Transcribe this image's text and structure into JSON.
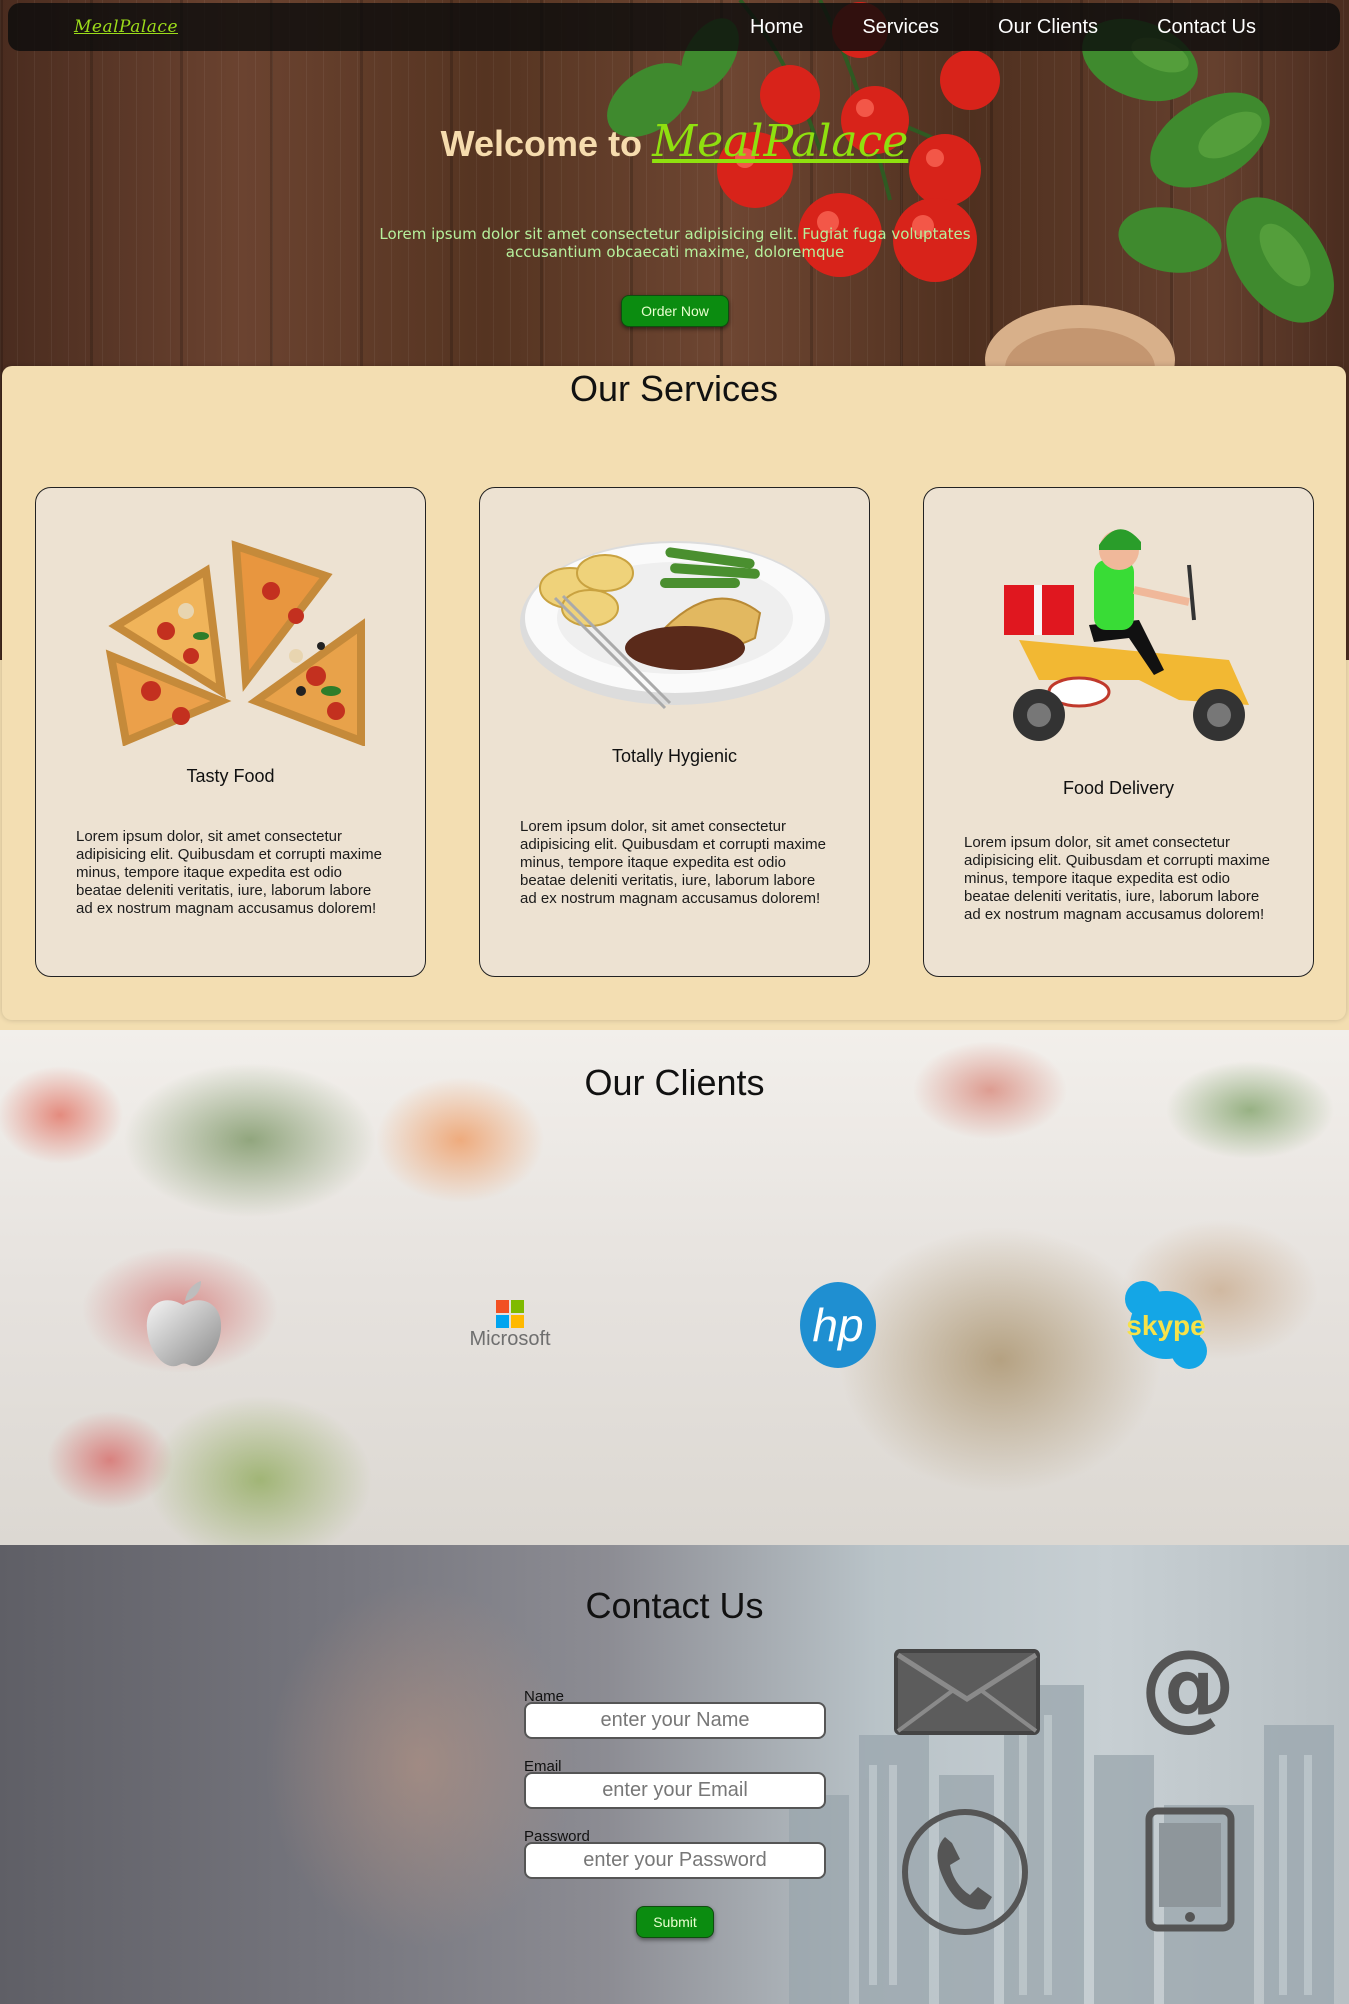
{
  "nav": {
    "logo": "MealPalace",
    "links": [
      "Home",
      "Services",
      "Our Clients",
      "Contact Us"
    ]
  },
  "hero": {
    "title_prefix": "Welcome to ",
    "brand": "MealPalace",
    "text": "Lorem ipsum dolor sit amet consectetur adipisicing elit. Fugiat fuga voluptates accusantium obcaecati maxime, doloremque",
    "button": "Order Now"
  },
  "services": {
    "title": "Our Services",
    "cards": [
      {
        "icon": "pizza-icon",
        "title": "Tasty Food",
        "text": "Lorem ipsum dolor, sit amet consectetur adipisicing elit. Quibusdam et corrupti maxime minus, tempore itaque expedita est odio beatae deleniti veritatis, iure, laborum labore ad ex nostrum magnam accusamus dolorem!"
      },
      {
        "icon": "meal-plate-icon",
        "title": "Totally Hygienic",
        "text": "Lorem ipsum dolor, sit amet consectetur adipisicing elit. Quibusdam et corrupti maxime minus, tempore itaque expedita est odio beatae deleniti veritatis, iure, laborum labore ad ex nostrum magnam accusamus dolorem!"
      },
      {
        "icon": "delivery-scooter-icon",
        "title": "Food Delivery",
        "text": "Lorem ipsum dolor, sit amet consectetur adipisicing elit. Quibusdam et corrupti maxime minus, tempore itaque expedita est odio beatae deleniti veritatis, iure, laborum labore ad ex nostrum magnam accusamus dolorem!"
      }
    ]
  },
  "clients": {
    "title": "Our Clients",
    "logos": [
      "apple-logo",
      "microsoft-logo",
      "hp-logo",
      "skype-logo"
    ],
    "microsoft_label": "Microsoft",
    "hp_label": "hp",
    "skype_label": "skype"
  },
  "contact": {
    "title": "Contact Us",
    "name_label": "Name",
    "name_placeholder": "enter your Name",
    "email_label": "Email",
    "email_placeholder": "enter your Email",
    "password_label": "Password",
    "password_placeholder": "enter your Password",
    "submit": "Submit",
    "icons": [
      "envelope-icon",
      "at-sign-icon",
      "phone-icon",
      "tablet-icon"
    ]
  },
  "colors": {
    "brand_green": "#8fe00f",
    "button_green": "#0b8c10",
    "services_bg": "#f3deb2",
    "card_bg": "#ede2d2",
    "hero_title": "#f6dcae"
  }
}
